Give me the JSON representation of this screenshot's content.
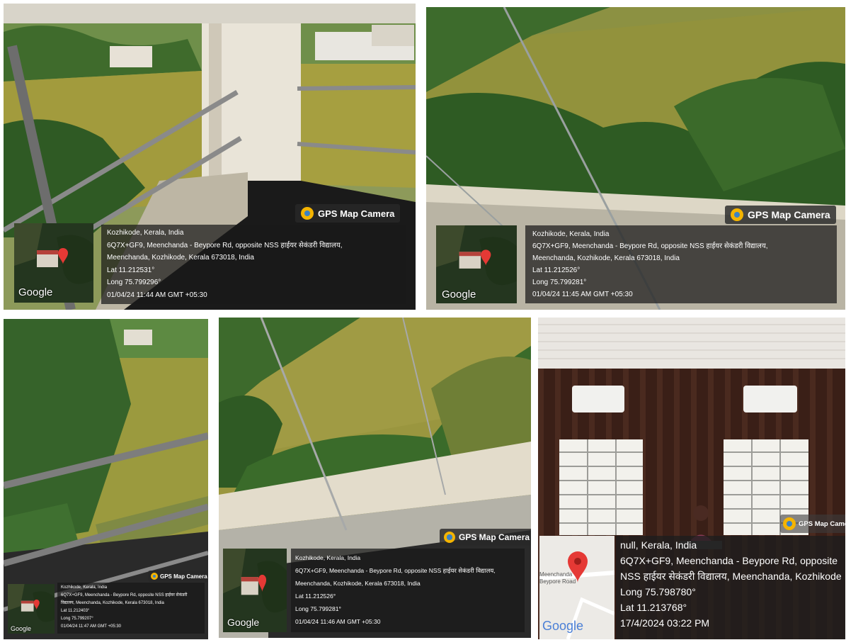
{
  "photos": [
    {
      "brand": "GPS Map Camera",
      "map_label": "Google",
      "lines": [
        "Kozhikode, Kerala, India",
        "6Q7X+GF9, Meenchanda - Beypore Rd, opposite NSS हाईयर सेकंडरी विद्यालय,",
        "Meenchanda, Kozhikode, Kerala 673018, India",
        "Lat 11.212531°",
        "Long 75.799296°",
        "01/04/24 11:44 AM GMT +05:30"
      ]
    },
    {
      "brand": "GPS Map Camera",
      "map_label": "Google",
      "lines": [
        "Kozhikode, Kerala, India",
        "6Q7X+GF9, Meenchanda - Beypore Rd, opposite NSS हाईयर सेकंडरी विद्यालय,",
        "Meenchanda, Kozhikode, Kerala 673018, India",
        "Lat 11.212526°",
        "Long 75.799281°",
        "01/04/24 11:45 AM GMT +05:30"
      ]
    },
    {
      "brand": "GPS Map Camera",
      "map_label": "Google",
      "lines": [
        "Kozhikode, Kerala, India",
        "6Q7X+GF9, Meenchanda - Beypore Rd, opposite NSS हाईयर सेकंडरी",
        "विद्यालय, Meenchanda, Kozhikode, Kerala 673018, India",
        "Lat 11.212403°",
        "Long 75.799207°",
        "01/04/24 11:47 AM GMT +05:30"
      ]
    },
    {
      "brand": "GPS Map Camera",
      "map_label": "Google",
      "lines": [
        "Kozhikode, Kerala, India",
        "6Q7X+GF9, Meenchanda - Beypore Rd, opposite NSS हाईयर सेकंडरी विद्यालय,",
        "Meenchanda, Kozhikode, Kerala 673018, India",
        "Lat 11.212526°",
        "Long 75.799281°",
        "01/04/24 11:46 AM GMT +05:30"
      ]
    },
    {
      "brand": "GPS Map Camera",
      "map_label": "Google",
      "map_place": "Meenchanda Beypore Road",
      "lines": [
        "null, Kerala, India",
        "6Q7X+GF9, Meenchanda - Beypore Rd, opposite",
        "NSS हाईयर सेकंडरी विद्यालय, Meenchanda, Kozhikode,",
        "Long 75.798780°",
        "Lat 11.213768°",
        "17/4/2024 03:22 PM"
      ]
    }
  ]
}
